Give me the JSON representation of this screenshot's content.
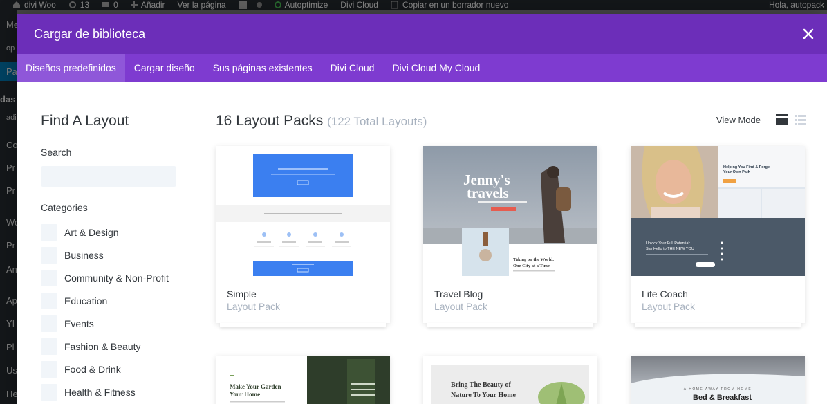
{
  "adminbar": {
    "site": "divi Woo",
    "updates": "13",
    "comments": "0",
    "new": "Añadir",
    "view": "Ver la página",
    "autoptimize": "Autoptimize",
    "divi_cloud": "Divi Cloud",
    "copy_draft": "Copiar en un borrador nuevo",
    "greeting": "Hola, autopack"
  },
  "modal": {
    "title": "Cargar de biblioteca",
    "tabs": [
      {
        "label": "Diseños predefinidos"
      },
      {
        "label": "Cargar diseño"
      },
      {
        "label": "Sus páginas existentes"
      },
      {
        "label": "Divi Cloud"
      },
      {
        "label": "Divi Cloud My Cloud"
      }
    ]
  },
  "sidebar": {
    "title": "Find A Layout",
    "search_label": "Search",
    "categories_label": "Categories",
    "categories": [
      {
        "label": "Art & Design"
      },
      {
        "label": "Business"
      },
      {
        "label": "Community & Non-Profit"
      },
      {
        "label": "Education"
      },
      {
        "label": "Events"
      },
      {
        "label": "Fashion & Beauty"
      },
      {
        "label": "Food & Drink"
      },
      {
        "label": "Health & Fitness"
      }
    ]
  },
  "main": {
    "title": "16 Layout Packs",
    "subtitle": "(122 Total Layouts)",
    "view_mode": "View Mode",
    "cards": [
      {
        "name": "Simple",
        "type": "Layout Pack"
      },
      {
        "name": "Travel Blog",
        "type": "Layout Pack",
        "thumb_title": "Jenny's travels",
        "thumb_caption": "Taking on the World, One City at a Time"
      },
      {
        "name": "Life Coach",
        "type": "Layout Pack",
        "thumb_heading": "Helping You Find & Forge Your Own Path",
        "thumb_sub": "Unlock Your Full Potential: Say Hello to THE NEW YOU"
      }
    ],
    "partial_cards": [
      {
        "thumb_text": "Make Your Garden Your Home"
      },
      {
        "thumb_text": "Bring The Beauty of Nature To Your Home"
      },
      {
        "thumb_text": "Bed & Breakfast",
        "thumb_eyebrow": "A HOME AWAY FROM HOME"
      }
    ]
  },
  "colors": {
    "header": "#6c2eb9",
    "tabs": "#7e3bd0",
    "active_tab": "#8f57d9"
  }
}
